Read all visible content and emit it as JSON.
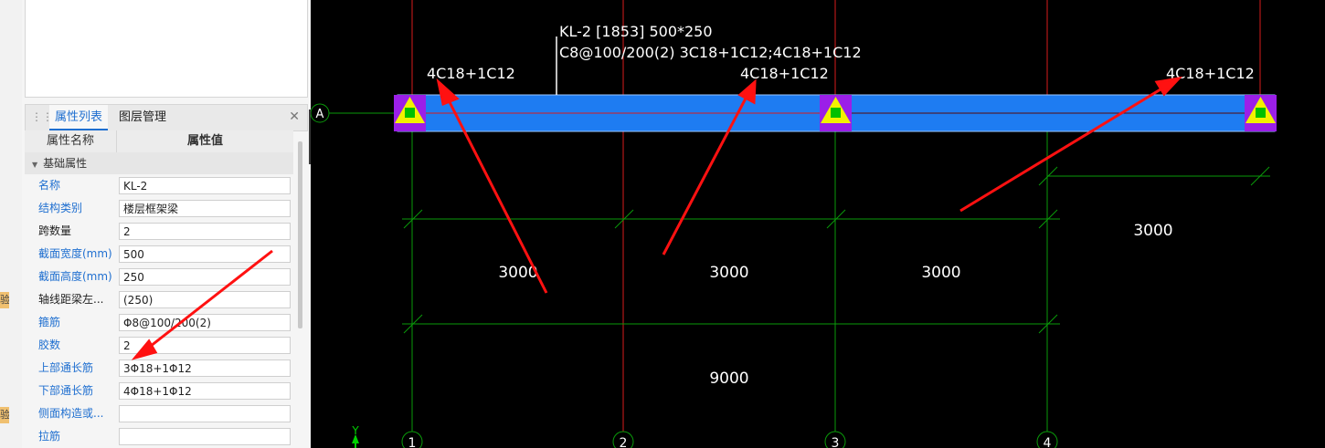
{
  "properties_panel": {
    "tabs": [
      {
        "label": "属性列表",
        "active": true
      },
      {
        "label": "图层管理",
        "active": false
      }
    ],
    "columns": {
      "name": "属性名称",
      "value": "属性值"
    },
    "group_label": "基础属性",
    "rows": [
      {
        "name": "名称",
        "value": "KL-2",
        "blue": true
      },
      {
        "name": "结构类别",
        "value": "楼层框架梁",
        "blue": true
      },
      {
        "name": "跨数量",
        "value": "2",
        "blue": false
      },
      {
        "name": "截面宽度(mm)",
        "value": "500",
        "blue": true
      },
      {
        "name": "截面高度(mm)",
        "value": "250",
        "blue": true
      },
      {
        "name": "轴线距梁左...",
        "value": "(250)",
        "blue": false
      },
      {
        "name": "箍筋",
        "value": "Φ8@100/200(2)",
        "blue": true
      },
      {
        "name": "胶数",
        "value": "2",
        "blue": true
      },
      {
        "name": "上部通长筋",
        "value": "3Φ18+1Φ12",
        "blue": true
      },
      {
        "name": "下部通长筋",
        "value": "4Φ18+1Φ12",
        "blue": true
      },
      {
        "name": "侧面构造或...",
        "value": "",
        "blue": true
      },
      {
        "name": "拉筋",
        "value": "",
        "blue": true
      }
    ]
  },
  "left_strip": {
    "badges": [
      "验",
      "验"
    ]
  },
  "canvas": {
    "beam_label_line1": "KL-2 [1853] 500*250",
    "beam_label_line2": "C8@100/200(2) 3C18+1C12;4C18+1C12",
    "rebar_labels": [
      "4C18+1C12",
      "4C18+1C12",
      "4C18+1C12"
    ],
    "axis_row_label": "A",
    "axis_col_labels": [
      "1",
      "2",
      "3",
      "4"
    ],
    "dimensions": {
      "upper_row": [
        "3000",
        "3000",
        "3000"
      ],
      "right_span": "3000",
      "total": "9000"
    },
    "ucs_label": "Y",
    "colors": {
      "beam_fill": "#1e7cf2",
      "grid_green": "#0a9a0a",
      "axis_red": "#d81b1b",
      "arrow_red": "#ff1111",
      "support_purple": "#9b1fe8",
      "support_yellow": "#f2f200",
      "support_green": "#00c000"
    }
  }
}
